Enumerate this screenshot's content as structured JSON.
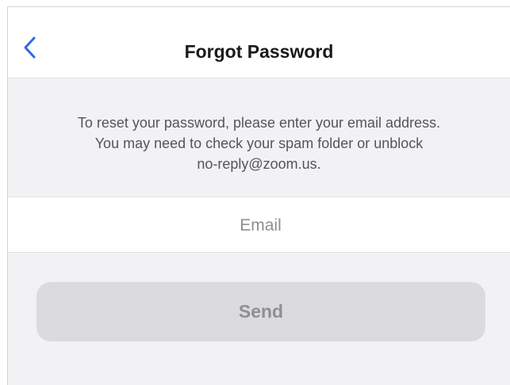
{
  "header": {
    "title": "Forgot Password",
    "back_icon": "chevron-left-icon",
    "accent_color": "#2d6cdf"
  },
  "instructions": {
    "line1": "To reset your password, please enter your email address.",
    "line2": "You may need to check your spam folder or unblock",
    "line3": "no-reply@zoom.us."
  },
  "email": {
    "value": "",
    "placeholder": "Email"
  },
  "send": {
    "label": "Send",
    "enabled": false
  }
}
